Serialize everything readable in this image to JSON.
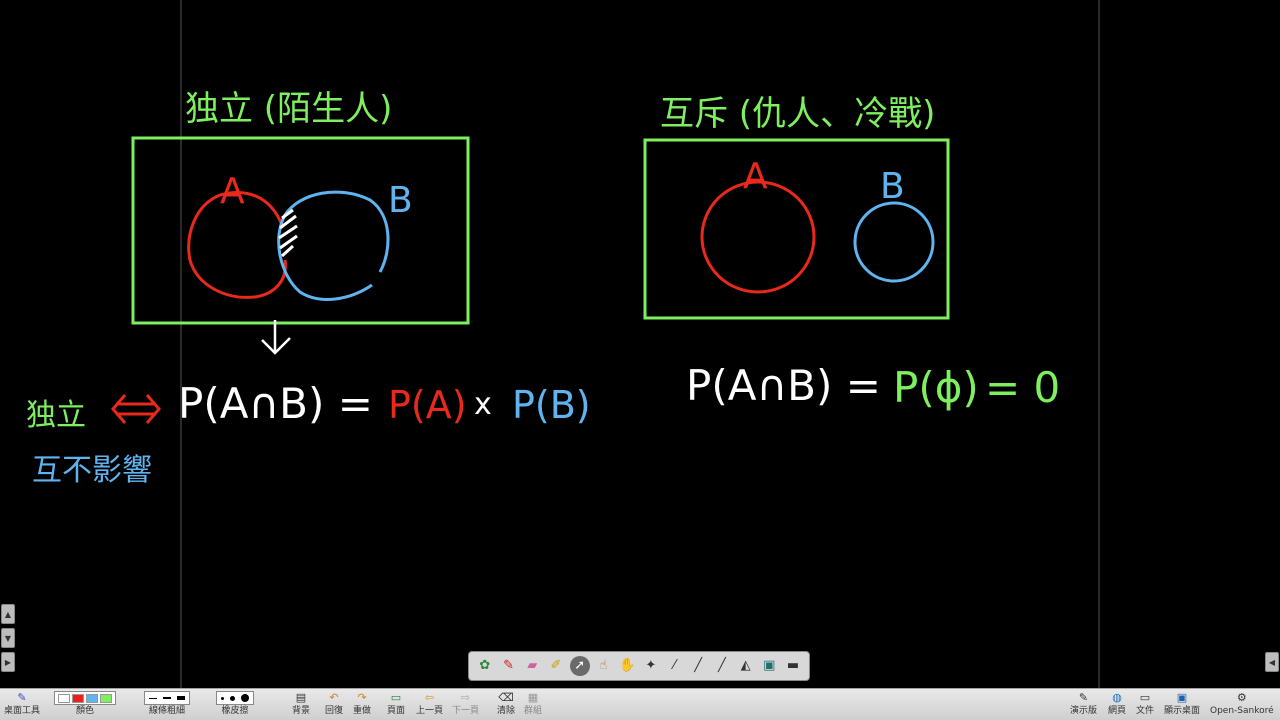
{
  "board": {
    "left_title": "独立 (陌生人)",
    "right_title": "互斥 (仇人、冷戰)",
    "left_label_a": "A",
    "left_label_b": "B",
    "right_label_a": "A",
    "right_label_b": "B",
    "independent_label": "独立",
    "iff_symbol": "⇔",
    "no_influence_label": "互不影響",
    "formula_left_main": "P(A∩B) =",
    "formula_left_pa": "P(A)",
    "formula_left_times": "x",
    "formula_left_pb": "P(B)",
    "formula_right_main": "P(A∩B) =",
    "formula_right_phi": "P(ϕ)",
    "formula_right_eq_zero": "= 0",
    "colors": {
      "green": "#7ef05f",
      "red": "#e8291c",
      "blue": "#5fb4f0",
      "white": "#ffffff"
    }
  },
  "pen_toolbar": {
    "tools": [
      "palette-icon",
      "pen-icon",
      "eraser-icon",
      "highlighter-icon",
      "pointer-icon",
      "hand-point-icon",
      "hand-icon",
      "magic-wand-icon",
      "laser-icon",
      "line-icon",
      "ruler-icon",
      "protractor-icon",
      "screen-icon",
      "minimize-icon"
    ]
  },
  "bottom_bar": {
    "desktop_tools": "桌面工具",
    "color": "顏色",
    "line_thickness": "線條粗細",
    "eraser": "橡皮擦",
    "background": "背景",
    "undo": "回復",
    "redo": "重做",
    "page": "頁面",
    "prev_page": "上一頁",
    "next_page": "下一頁",
    "clear": "清除",
    "group": "群組",
    "demo": "演示版",
    "web": "網頁",
    "document": "文件",
    "show_desktop": "顯示桌面",
    "brand": "Open-Sankoré"
  }
}
